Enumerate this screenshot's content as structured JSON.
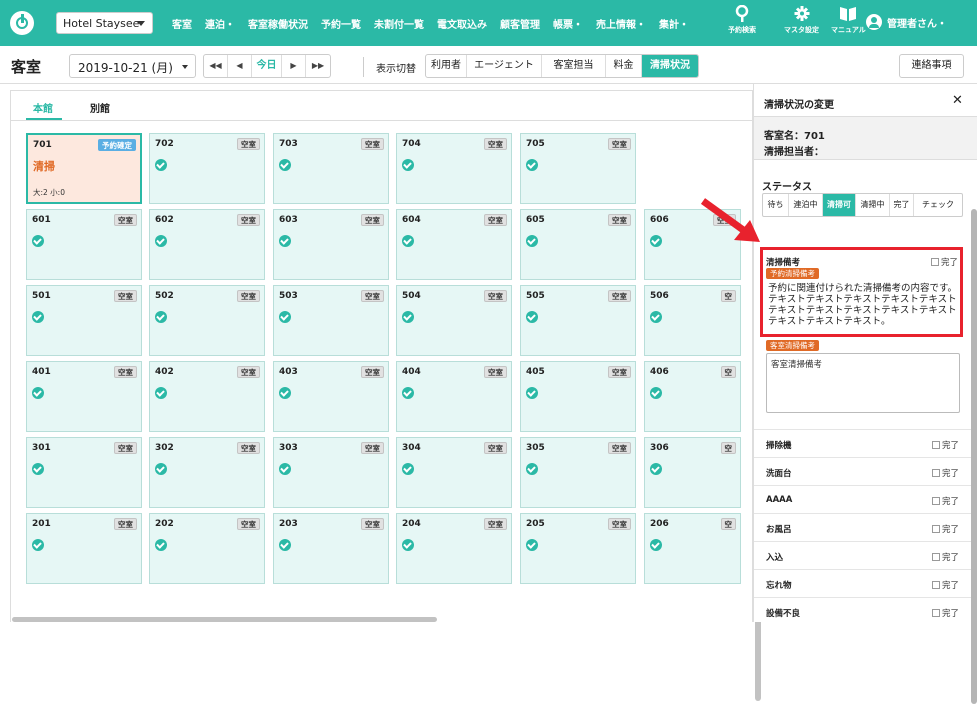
{
  "nav": {
    "hotel": "Hotel Staysee",
    "menu": [
      "客室",
      "連泊・",
      "客室稼働状況",
      "予約一覧",
      "未割付一覧",
      "電文取込み",
      "顧客管理",
      "帳票・",
      "売上情報・",
      "集計・"
    ],
    "icons": [
      {
        "name": "search-icon",
        "label": "予約検索"
      },
      {
        "name": "gear-icon",
        "label": "マスタ設定"
      },
      {
        "name": "book-icon",
        "label": "マニュアル"
      }
    ],
    "user": "管理者さん・"
  },
  "toolbar": {
    "page_title": "客室",
    "date": "2019-10-21 (月)",
    "pager": [
      "◀◀",
      "◀",
      "今日",
      "▶",
      "▶▶"
    ],
    "view_label": "表示切替",
    "views": [
      "利用者",
      "エージェント",
      "客室担当",
      "料金",
      "清掃状況"
    ],
    "active_view": "清掃状況",
    "notes_button": "連絡事項"
  },
  "tabs": [
    "本館",
    "別館"
  ],
  "rooms": [
    {
      "number": "701",
      "badge": "予約確定",
      "status": "清掃",
      "guests": "大:2 小:0"
    },
    {
      "number": "702",
      "badge": "空室"
    },
    {
      "number": "703",
      "badge": "空室"
    },
    {
      "number": "704",
      "badge": "空室"
    },
    {
      "number": "705",
      "badge": "空室"
    },
    {
      "number": "601",
      "badge": "空室"
    },
    {
      "number": "602",
      "badge": "空室"
    },
    {
      "number": "603",
      "badge": "空室"
    },
    {
      "number": "604",
      "badge": "空室"
    },
    {
      "number": "605",
      "badge": "空室"
    },
    {
      "number": "606",
      "badge": "空室"
    },
    {
      "number": "501",
      "badge": "空室"
    },
    {
      "number": "502",
      "badge": "空室"
    },
    {
      "number": "503",
      "badge": "空室"
    },
    {
      "number": "504",
      "badge": "空室"
    },
    {
      "number": "505",
      "badge": "空室"
    },
    {
      "number": "506",
      "badge": "空"
    },
    {
      "number": "401",
      "badge": "空室"
    },
    {
      "number": "402",
      "badge": "空室"
    },
    {
      "number": "403",
      "badge": "空室"
    },
    {
      "number": "404",
      "badge": "空室"
    },
    {
      "number": "405",
      "badge": "空室"
    },
    {
      "number": "406",
      "badge": "空"
    },
    {
      "number": "301",
      "badge": "空室"
    },
    {
      "number": "302",
      "badge": "空室"
    },
    {
      "number": "303",
      "badge": "空室"
    },
    {
      "number": "304",
      "badge": "空室"
    },
    {
      "number": "305",
      "badge": "空室"
    },
    {
      "number": "306",
      "badge": "空"
    },
    {
      "number": "201",
      "badge": "空室"
    },
    {
      "number": "202",
      "badge": "空室"
    },
    {
      "number": "203",
      "badge": "空室"
    },
    {
      "number": "204",
      "badge": "空室"
    },
    {
      "number": "205",
      "badge": "空室"
    },
    {
      "number": "206",
      "badge": "空"
    }
  ],
  "panel": {
    "title": "清掃状況の変更",
    "close": "✕",
    "room_name": "客室名：701",
    "cleaner": "清掃担当者：",
    "status_label": "ステータス",
    "statuses": [
      "待ち",
      "連泊中",
      "清掃可",
      "清掃中",
      "完了",
      "チェック"
    ],
    "active_status": "清掃可",
    "done_label": "完了",
    "cleaning_notes_title": "清掃備考",
    "reservation_notes_tag": "予約清掃備考",
    "reservation_notes_text": "予約に関連付けられた清掃備考の内容です。テキストテキストテキストテキストテキストテキストテキストテキストテキストテキストテキストテキストテキスト。",
    "room_notes_tag": "客室清掃備考",
    "room_notes_text": "客室清掃備考",
    "items": [
      "掃除機",
      "洗面台",
      "AAAA",
      "お風呂",
      "入込",
      "忘れ物",
      "設備不良"
    ]
  },
  "colors": {
    "accent": "#2bb9a6",
    "highlight": "#e8222d",
    "orange": "#e06a26",
    "badge_blue": "#5aaee3"
  }
}
